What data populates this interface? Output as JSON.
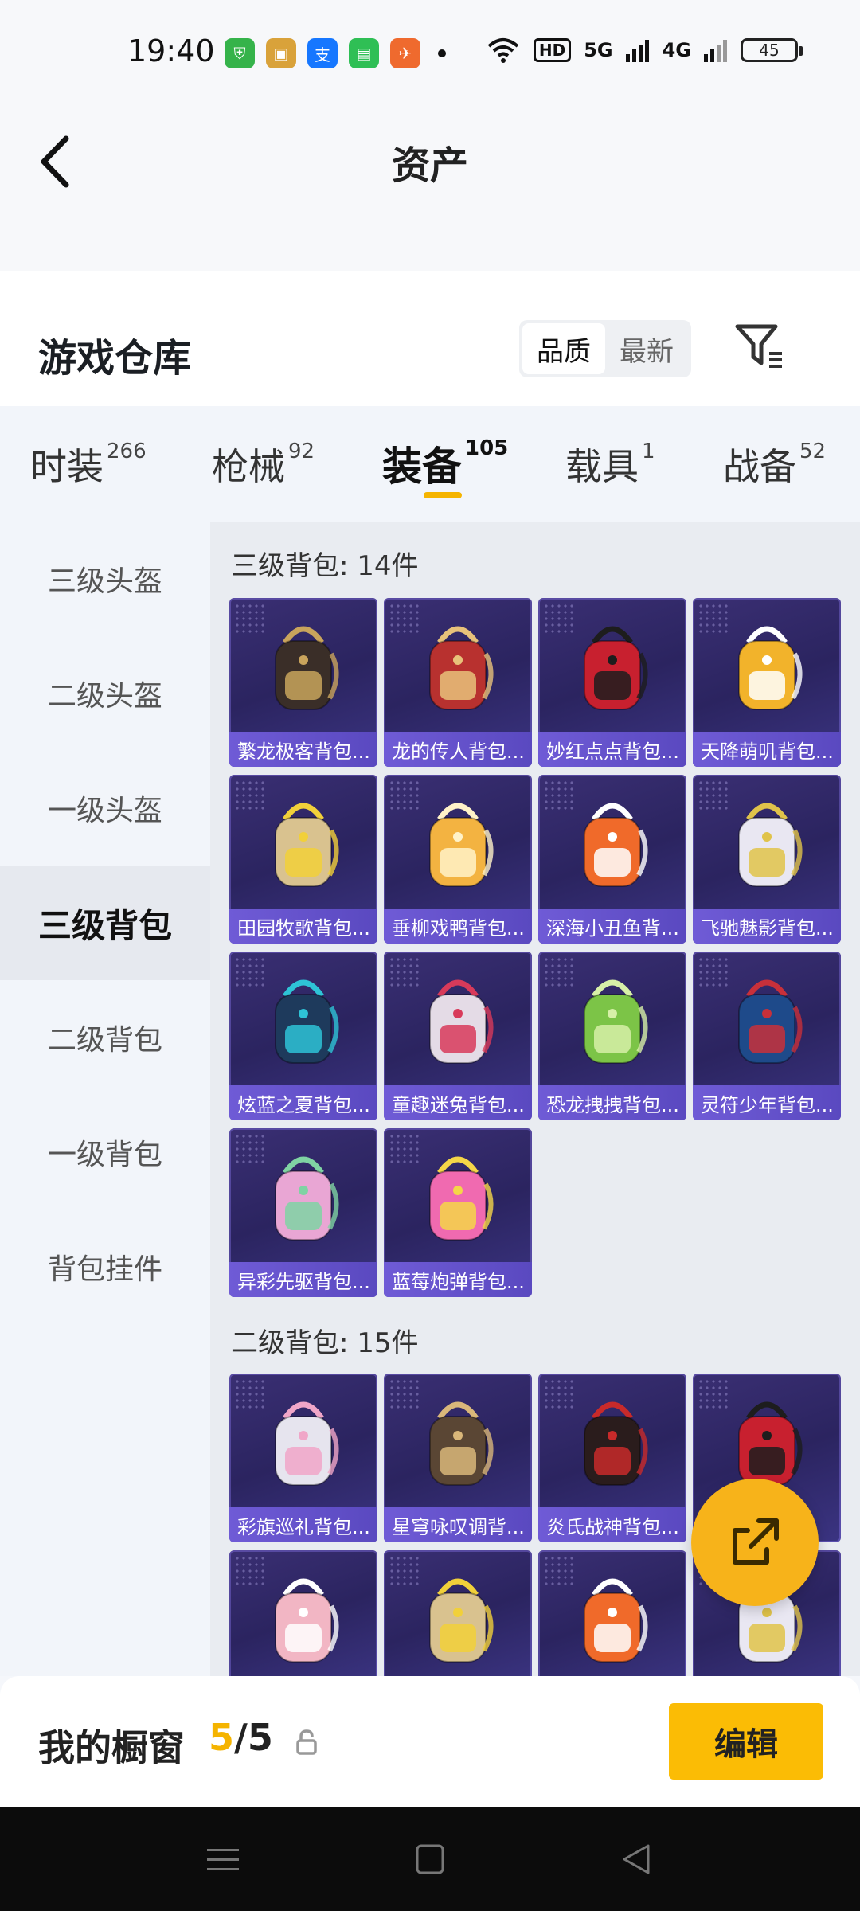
{
  "status_bar": {
    "time": "19:40",
    "apps": [
      {
        "name": "shield-app-icon",
        "color": "#35b34a",
        "glyph": "⛨"
      },
      {
        "name": "game-app-icon",
        "color": "#d9a23a",
        "glyph": "▣"
      },
      {
        "name": "alipay-app-icon",
        "color": "#1677ff",
        "glyph": "支"
      },
      {
        "name": "message-app-icon",
        "color": "#2fbf55",
        "glyph": "▤"
      },
      {
        "name": "cf-app-icon",
        "color": "#ef6a2e",
        "glyph": "✈"
      }
    ],
    "hd_label": "HD",
    "net1": "5G",
    "net2": "4G",
    "battery": "45"
  },
  "header": {
    "title": "资产"
  },
  "warehouse": {
    "title": "游戏仓库",
    "sort_options": [
      "品质",
      "最新"
    ],
    "sort_selected": "品质"
  },
  "tabs": [
    {
      "label": "时装",
      "count": "266"
    },
    {
      "label": "枪械",
      "count": "92"
    },
    {
      "label": "装备",
      "count": "105"
    },
    {
      "label": "载具",
      "count": "1"
    },
    {
      "label": "战备",
      "count": "52"
    }
  ],
  "sidebar": {
    "items": [
      "三级头盔",
      "二级头盔",
      "一级头盔",
      "三级背包",
      "二级背包",
      "一级背包",
      "背包挂件"
    ],
    "active": "三级背包"
  },
  "sections": [
    {
      "title": "三级背包: 14件",
      "items": [
        {
          "label": "繁龙极客背包...",
          "color": "#3a2e28",
          "accent": "#c9a45c"
        },
        {
          "label": "龙的传人背包...",
          "color": "#b8312f",
          "accent": "#e8c27a"
        },
        {
          "label": "妙红点点背包...",
          "color": "#c8202f",
          "accent": "#1d1d1d"
        },
        {
          "label": "天降萌叽背包...",
          "color": "#f2b32b",
          "accent": "#ffffff"
        },
        {
          "label": "田园牧歌背包...",
          "color": "#d9c28f",
          "accent": "#f1d03a"
        },
        {
          "label": "垂柳戏鸭背包...",
          "color": "#f3b341",
          "accent": "#fff2c8"
        },
        {
          "label": "深海小丑鱼背...",
          "color": "#f06a2a",
          "accent": "#ffffff"
        },
        {
          "label": "飞驰魅影背包...",
          "color": "#e9e7f2",
          "accent": "#e0c34a"
        },
        {
          "label": "炫蓝之夏背包...",
          "color": "#1e3a5c",
          "accent": "#2ec3d6"
        },
        {
          "label": "童趣迷兔背包...",
          "color": "#e4dbe6",
          "accent": "#d83a5a"
        },
        {
          "label": "恐龙拽拽背包...",
          "color": "#7cc447",
          "accent": "#d7f0a8"
        },
        {
          "label": "灵符少年背包...",
          "color": "#1e4a8a",
          "accent": "#c8303a"
        },
        {
          "label": "异彩先驱背包...",
          "color": "#e9a6d4",
          "accent": "#7fd3a3"
        },
        {
          "label": "蓝莓炮弹背包...",
          "color": "#f06ab0",
          "accent": "#f5d648"
        }
      ]
    },
    {
      "title": "二级背包: 15件",
      "items": [
        {
          "label": "彩旗巡礼背包...",
          "color": "#e6e4ee",
          "accent": "#f0a6c8"
        },
        {
          "label": "星穹咏叹调背...",
          "color": "#5a4634",
          "accent": "#d9b77a"
        },
        {
          "label": "炎氏战神背包...",
          "color": "#2a1c1c",
          "accent": "#c82a2a"
        },
        {
          "label": "",
          "color": "#c8202f",
          "accent": "#1d1d1d"
        },
        {
          "label": "",
          "color": "#f2b6c4",
          "accent": "#ffffff"
        },
        {
          "label": "",
          "color": "#d9c28f",
          "accent": "#f1d03a"
        },
        {
          "label": "",
          "color": "#f06a2a",
          "accent": "#ffffff"
        },
        {
          "label": "",
          "color": "#e9e7f2",
          "accent": "#e0c34a"
        }
      ]
    }
  ],
  "showcase": {
    "label": "我的橱窗",
    "current": "5",
    "sep_total": "/5",
    "edit_label": "编辑"
  },
  "colors": {
    "accent": "#f5b400",
    "card_label": "#5a49c0",
    "fab": "#f7b31a"
  }
}
